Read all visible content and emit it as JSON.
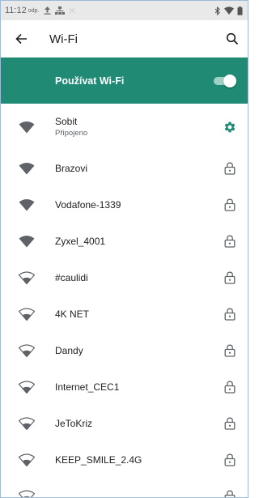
{
  "status_bar": {
    "time": "11:12",
    "time_suffix": "odp.",
    "icons": [
      "upload-icon",
      "network-icon",
      "bluetooth-icon",
      "signal-icon",
      "battery-icon"
    ]
  },
  "app_bar": {
    "title": "Wi-Fi",
    "back_icon": "arrow-left-icon",
    "search_icon": "search-icon"
  },
  "wifi_toggle": {
    "label": "Používat Wi-Fi",
    "enabled": true,
    "accent_color": "#218a75"
  },
  "networks": [
    {
      "name": "Sobit",
      "status": "Připojeno",
      "secured": false,
      "connected": true,
      "action_icon": "gear-icon",
      "signal_style": "filled"
    },
    {
      "name": "Brazovi",
      "secured": true,
      "connected": false,
      "action_icon": "lock-icon",
      "signal_style": "filled"
    },
    {
      "name": "Vodafone-1339",
      "secured": true,
      "connected": false,
      "action_icon": "lock-icon",
      "signal_style": "filled"
    },
    {
      "name": "Zyxel_4001",
      "secured": true,
      "connected": false,
      "action_icon": "lock-icon",
      "signal_style": "filled"
    },
    {
      "name": "#caulidi",
      "secured": true,
      "connected": false,
      "action_icon": "lock-icon",
      "signal_style": "outlined"
    },
    {
      "name": "4K NET",
      "secured": true,
      "connected": false,
      "action_icon": "lock-icon",
      "signal_style": "outlined"
    },
    {
      "name": "Dandy",
      "secured": true,
      "connected": false,
      "action_icon": "lock-icon",
      "signal_style": "outlined"
    },
    {
      "name": "Internet_CEC1",
      "secured": true,
      "connected": false,
      "action_icon": "lock-icon",
      "signal_style": "outlined"
    },
    {
      "name": "JeToKriz",
      "secured": true,
      "connected": false,
      "action_icon": "lock-icon",
      "signal_style": "outlined"
    },
    {
      "name": "KEEP_SMILE_2.4G",
      "secured": true,
      "connected": false,
      "action_icon": "lock-icon",
      "signal_style": "outlined"
    },
    {
      "name": "",
      "secured": true,
      "connected": false,
      "action_icon": "lock-icon",
      "signal_style": "outlined"
    }
  ]
}
